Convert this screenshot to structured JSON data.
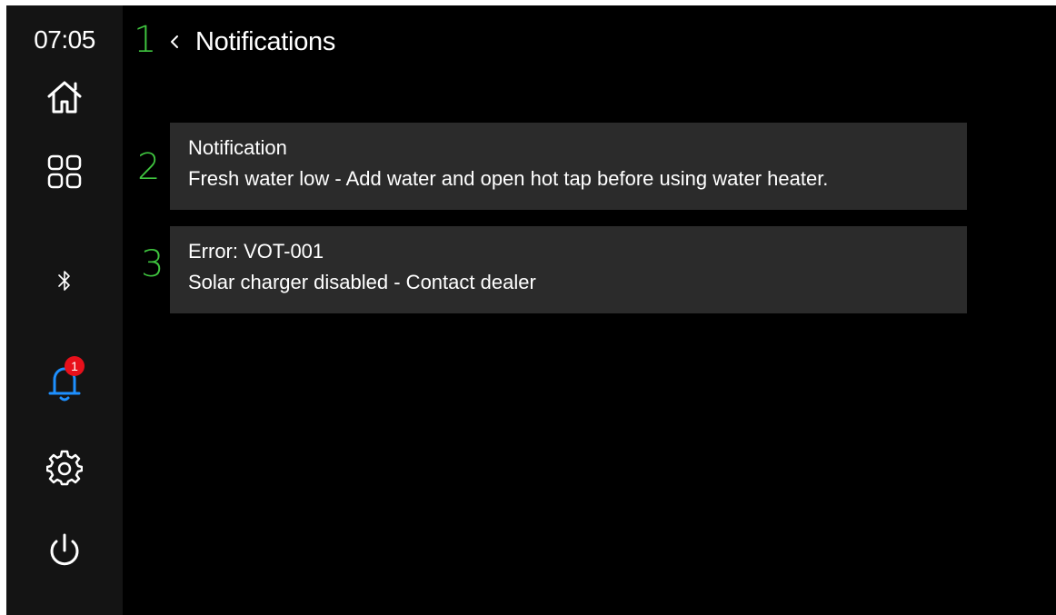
{
  "status_bar": {
    "time": "07:05"
  },
  "sidebar": {
    "items": [
      {
        "name": "home",
        "icon": "home-icon"
      },
      {
        "name": "apps",
        "icon": "apps-grid-icon"
      },
      {
        "name": "bluetooth",
        "icon": "bluetooth-icon"
      },
      {
        "name": "notifications",
        "icon": "bell-icon",
        "active": true,
        "badge": "1"
      },
      {
        "name": "settings",
        "icon": "gear-icon"
      },
      {
        "name": "power",
        "icon": "power-icon"
      }
    ],
    "active_color": "#1e90ff",
    "badge_color": "#e8101b"
  },
  "header": {
    "title": "Notifications",
    "back_icon": "chevron-left-icon"
  },
  "annotations": [
    "1",
    "2",
    "3"
  ],
  "notifications": [
    {
      "title": "Notification",
      "message": "Fresh water low - Add water and open hot tap before using water heater."
    },
    {
      "title": "Error: VOT-001",
      "message": "Solar charger disabled - Contact dealer"
    }
  ],
  "colors": {
    "background": "#000000",
    "sidebar": "#141414",
    "card": "#2b2b2b",
    "annotation": "#3fc43f",
    "text": "#ffffff"
  }
}
